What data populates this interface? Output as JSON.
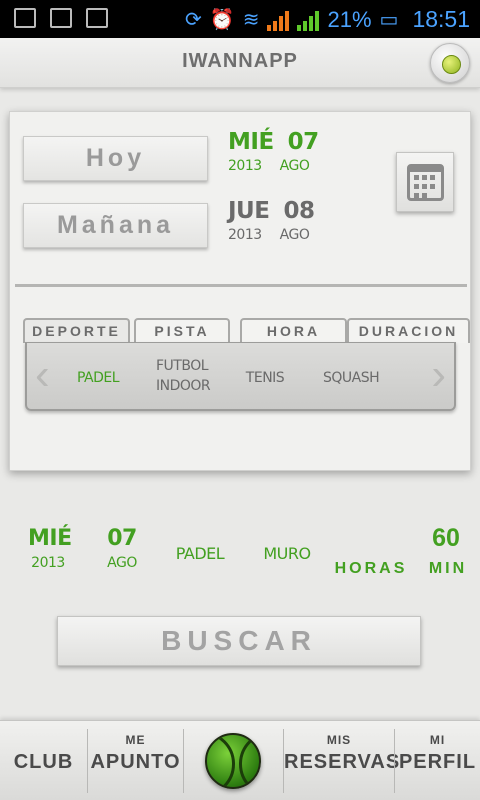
{
  "status_bar": {
    "battery_percent": "21%",
    "time": "18:51"
  },
  "app_bar": {
    "title": "IWANNAPP"
  },
  "day_selector": {
    "today_label": "Hoy",
    "tomorrow_label": "Mañana",
    "today_date": {
      "weekday": "MIÉ",
      "day": "07",
      "year": "2013",
      "month": "AGO"
    },
    "tomorrow_date": {
      "weekday": "JUE",
      "day": "08",
      "year": "2013",
      "month": "AGO"
    }
  },
  "tabs": [
    {
      "label": "DEPORTE"
    },
    {
      "label": "PISTA"
    },
    {
      "label": "HORA"
    },
    {
      "label": "DURACION"
    }
  ],
  "sports": [
    {
      "line1": "PADEL",
      "line2": ""
    },
    {
      "line1": "FUTBOL",
      "line2": "INDOOR"
    },
    {
      "line1": "TENIS",
      "line2": ""
    },
    {
      "line1": "SQUASH",
      "line2": ""
    }
  ],
  "summary": {
    "weekday": "MIÉ",
    "year": "2013",
    "day": "07",
    "month": "AGO",
    "sport": "PADEL",
    "court": "MURO",
    "duration_value": "60",
    "hours_label": "HORAS",
    "min_label": "MIN"
  },
  "search_button": "BUSCAR",
  "bottom_nav": [
    {
      "top": "",
      "bottom": "CLUB"
    },
    {
      "top": "ME",
      "bottom": "APUNTO"
    },
    {
      "top": "MIS",
      "bottom": "RESERVAS"
    },
    {
      "top": "MI",
      "bottom": "PERFIL"
    }
  ],
  "colors": {
    "accent_green": "#43a021",
    "status_blue": "#4ba3ff"
  }
}
